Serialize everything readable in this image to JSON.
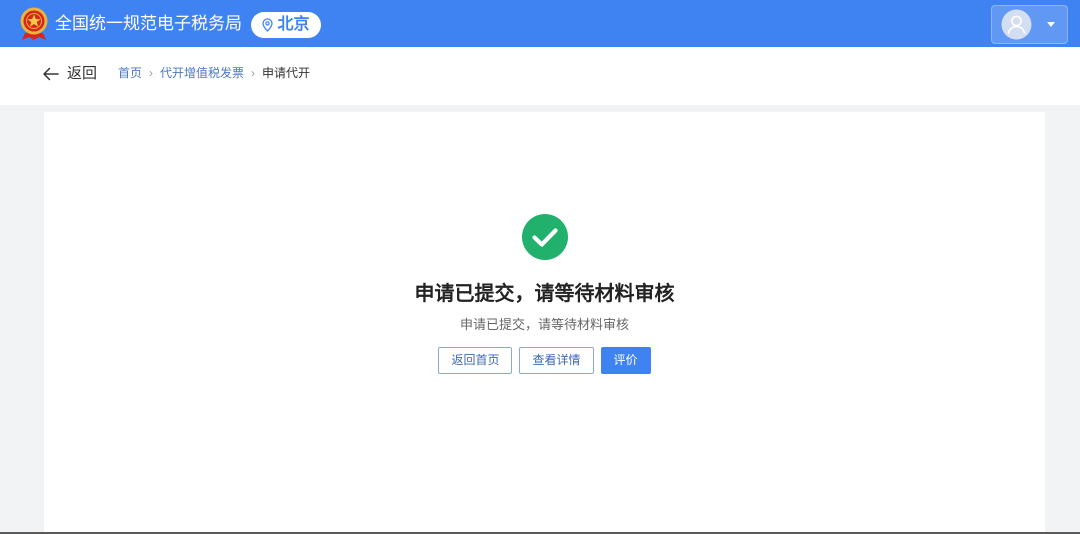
{
  "header": {
    "title": "全国统一规范电子税务局",
    "location": "北京",
    "icons": {
      "logo": "tax-emblem-icon",
      "location": "location-pin-icon",
      "user": "avatar-icon",
      "menu": "caret-down-icon"
    }
  },
  "nav": {
    "back_label": "返回",
    "back_icon": "arrow-left-icon",
    "separator": "›",
    "breadcrumb": [
      {
        "label": "首页"
      },
      {
        "label": "代开增值税发票"
      },
      {
        "label": "申请代开"
      }
    ]
  },
  "result": {
    "status_icon": "success-check-icon",
    "title": "申请已提交，请等待材料审核",
    "subtitle": "申请已提交，请等待材料审核",
    "buttons": {
      "home": "返回首页",
      "details": "查看详情",
      "rate": "评价"
    }
  },
  "colors": {
    "accent": "#3f82f2",
    "link": "#4a78c2",
    "success": "#21b16d"
  }
}
